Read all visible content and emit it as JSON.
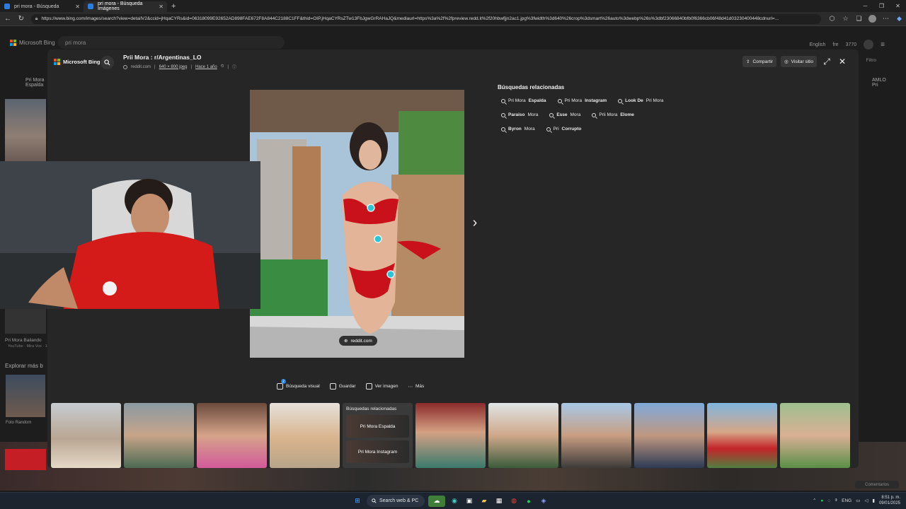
{
  "browser": {
    "tabs": [
      {
        "title": "pri mora - Búsqueda",
        "active": false
      },
      {
        "title": "pri mora - Búsqueda Imágenes",
        "active": true
      }
    ],
    "url": "https://www.bing.com/images/search?view=detailV2&ccid=jHqaCYRs&id=06318099E92652AD898FAE672F8A844C2188C1FF&thid=OIP.jHqaCYRsZTw13FbJgwGrRAHaJQ&mediaurl=https%3a%2f%2fpreview.redd.it%2f20hbwfjjn2ac1.jpg%3fwidth%3d640%26crop%3dsmart%26auto%3dwebp%26s%3dbf23066840bfb0f6366cb06f48d41d03230400448cdnurl=..."
  },
  "bing_bg": {
    "logo": "Microsoft Bing",
    "search_value": "pri mora",
    "lang": "English",
    "user_initial": "fre",
    "points": "3770",
    "filter": "Filtro",
    "left_label_1": "Pri Mora",
    "left_label_1b": "Espalda",
    "left_label_2": "Pri Mora Bailando",
    "left_label_2_sub": "YouTube · Mira Vox · 1",
    "explore": "Explorar más b",
    "foto_random": "Foto Random",
    "right_label": "AMLO",
    "right_label_sub": "Pri",
    "comentarios": "Comentarios"
  },
  "overlay": {
    "logo": "Microsoft Bing",
    "title": "Prii Mora : r/Argentinas_LO",
    "source": "reddit.com",
    "dimensions": "640 × 800 jpeg",
    "age": "Hace 1 año",
    "share_label": "Compartir",
    "visit_label": "Visitar sitio",
    "image_source_pill": "reddit.com",
    "related_title": "Búsquedas relacionadas",
    "related": [
      {
        "pre": "Pri Mora ",
        "bold": "Espalda"
      },
      {
        "pre": "Pri Mora ",
        "bold": "Instagram"
      },
      {
        "pre": "",
        "bold": "Look De",
        "post": " Pri Mora"
      },
      {
        "pre": "",
        "bold": "Paraiso",
        "post": " Mora"
      },
      {
        "pre": "",
        "bold": "Esse",
        "post": " Mora"
      },
      {
        "pre": "Prii Mora ",
        "bold": "Elome"
      },
      {
        "pre": "",
        "bold": "Byron",
        "post": " Mora"
      },
      {
        "pre": "Pri ",
        "bold": "Corrupto"
      }
    ],
    "actions": {
      "visual_search": "Búsqueda visual",
      "visual_badge": "2",
      "save": "Guardar",
      "view_image": "Ver imagen",
      "more": "Más"
    },
    "strip_related": {
      "title": "Búsquedas relacionadas",
      "item1": "Pri Mora Espalda",
      "item2": "Pri Mora Instagram"
    }
  },
  "taskbar": {
    "search": "Search web & PC",
    "lang": "ENG",
    "time": "8:51 p. m.",
    "date": "09/01/2025"
  },
  "colors": {
    "accent": "#2a7de1",
    "overlay_bg": "#262626",
    "hotspot": "#29c6d8"
  }
}
